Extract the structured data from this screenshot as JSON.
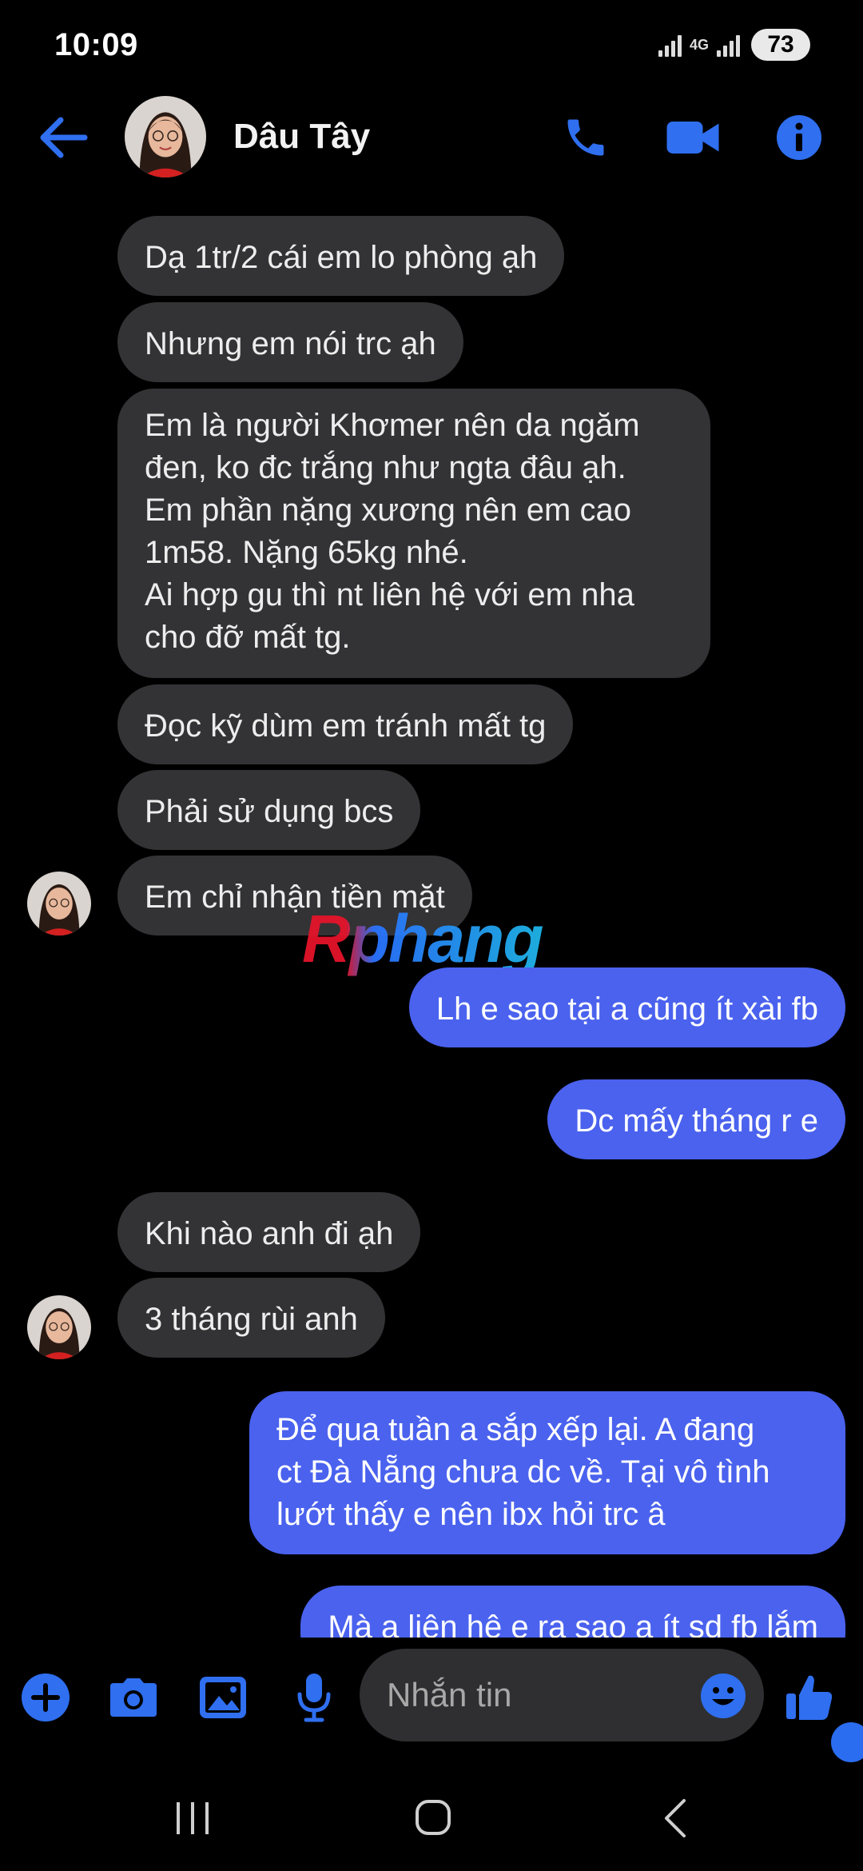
{
  "status": {
    "time": "10:09",
    "network": "4G",
    "battery": "73"
  },
  "header": {
    "contact_name": "Dâu Tây"
  },
  "messages": [
    {
      "dir": "in",
      "text": "Dạ 1tr/2 cái em lo phòng ạh"
    },
    {
      "dir": "in",
      "text": "Nhưng em nói trc ạh"
    },
    {
      "dir": "in",
      "text": "Em là người Khơmer nên da ngăm\nđen, ko đc trắng như ngta đâu ạh.\nEm phần nặng xương nên em cao\n1m58. Nặng 65kg nhé.\nAi hợp gu thì nt liên hệ với em nha\ncho đỡ mất tg."
    },
    {
      "dir": "in",
      "text": "Đọc kỹ dùm em tránh mất tg"
    },
    {
      "dir": "in",
      "text": "Phải sử dụng bcs"
    },
    {
      "dir": "in",
      "text": "Em chỉ nhận tiền mặt"
    },
    {
      "dir": "out",
      "text": "Lh e sao tại a cũng ít xài fb"
    },
    {
      "dir": "out",
      "text": "Dc mấy tháng r e"
    },
    {
      "dir": "in",
      "text": "Khi nào anh đi ạh"
    },
    {
      "dir": "in",
      "text": "3 tháng rùi anh"
    },
    {
      "dir": "out",
      "text": "Để qua tuần a sắp xếp lại. A đang\nct Đà Nẵng chưa dc về. Tại vô tình\nlướt thấy e nên ibx hỏi trc â"
    },
    {
      "dir": "out",
      "text": "Mà a liên hệ e ra sao a ít sd fb lắm"
    }
  ],
  "watermark": "Rphang",
  "composer": {
    "placeholder": "Nhắn tin"
  },
  "colors": {
    "accent": "#4a62ee",
    "incoming_bubble": "#333335",
    "icon_blue": "#2f6ff0"
  }
}
